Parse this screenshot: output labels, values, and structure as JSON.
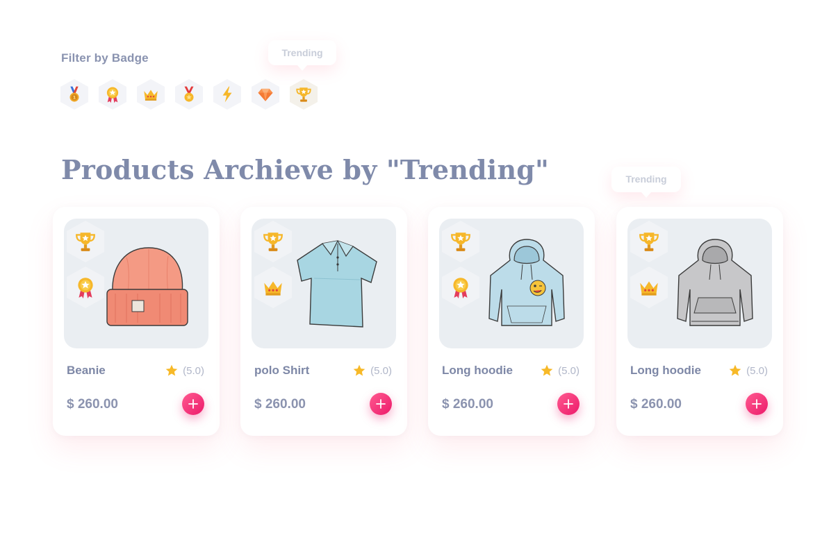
{
  "filter": {
    "label": "Filter by Badge",
    "badges": [
      {
        "icon": "medal-ribbon-icon"
      },
      {
        "icon": "rosette-star-icon"
      },
      {
        "icon": "crown-icon"
      },
      {
        "icon": "gold-medal-icon"
      },
      {
        "icon": "lightning-icon"
      },
      {
        "icon": "diamond-icon"
      },
      {
        "icon": "trophy-icon",
        "selected": true
      }
    ],
    "tooltip": "Trending"
  },
  "heading": "Products Archieve by \"Trending\"",
  "card_tooltip": "Trending",
  "products": [
    {
      "name": "Beanie",
      "rating": "(5.0)",
      "price": "$ 260.00",
      "badges": [
        "trophy-icon",
        "rosette-star-icon"
      ],
      "image": "beanie"
    },
    {
      "name": "polo Shirt",
      "rating": "(5.0)",
      "price": "$ 260.00",
      "badges": [
        "trophy-icon",
        "crown-icon"
      ],
      "image": "polo-shirt"
    },
    {
      "name": "Long hoodie",
      "rating": "(5.0)",
      "price": "$ 260.00",
      "badges": [
        "trophy-icon",
        "rosette-star-icon"
      ],
      "image": "hoodie-blue"
    },
    {
      "name": "Long hoodie",
      "rating": "(5.0)",
      "price": "$ 260.00",
      "badges": [
        "trophy-icon",
        "crown-icon"
      ],
      "image": "hoodie-grey"
    }
  ],
  "colors": {
    "accent": "#ec1a6a",
    "text": "#7d87a6",
    "star": "#f7b928",
    "card_image_bg": "#eaeef2"
  }
}
